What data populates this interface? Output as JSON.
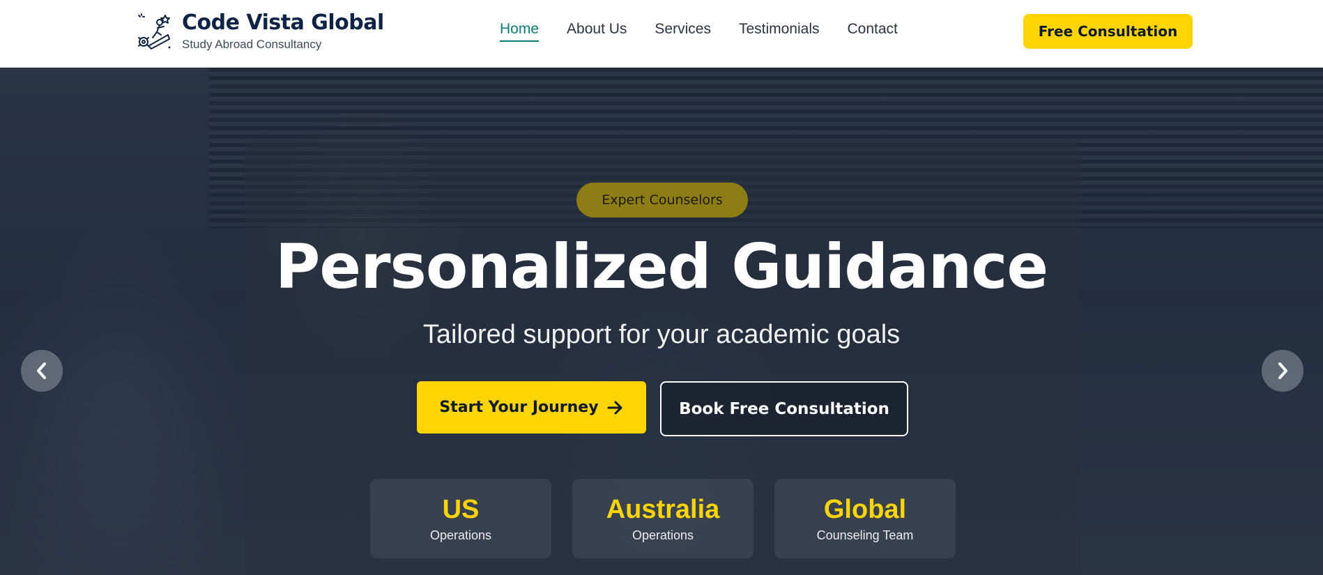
{
  "header": {
    "brand": "Code Vista Global",
    "tagline": "Study Abroad Consultancy",
    "logo_icon": "graduate-climbing-icon",
    "nav": [
      {
        "label": "Home",
        "active": true
      },
      {
        "label": "About Us",
        "active": false
      },
      {
        "label": "Services",
        "active": false
      },
      {
        "label": "Testimonials",
        "active": false
      },
      {
        "label": "Contact",
        "active": false
      }
    ],
    "cta_label": "Free Consultation"
  },
  "hero": {
    "badge": "Expert Counselors",
    "title": "Personalized Guidance",
    "subtitle": "Tailored support for your academic goals",
    "primary_button": "Start Your Journey",
    "primary_button_icon": "arrow-right-icon",
    "secondary_button": "Book Free Consultation",
    "stats": [
      {
        "value": "US",
        "label": "Operations"
      },
      {
        "value": "Australia",
        "label": "Operations"
      },
      {
        "value": "Global",
        "label": "Counseling Team"
      }
    ],
    "prev_icon": "chevron-left-icon",
    "next_icon": "chevron-right-icon"
  },
  "colors": {
    "brand_navy": "#0f2444",
    "accent_yellow": "#ffd400",
    "active_teal": "#0d7d7a"
  }
}
